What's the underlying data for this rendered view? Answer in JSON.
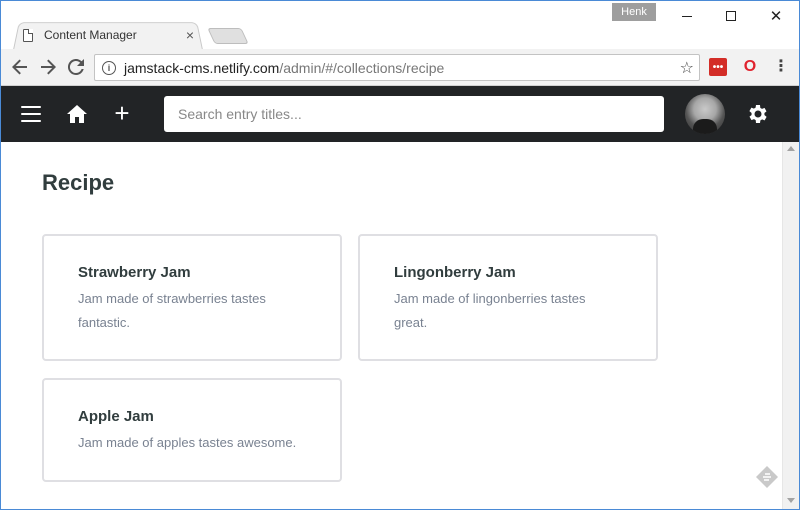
{
  "browser": {
    "tab_title": "Content Manager",
    "tab_close": "×",
    "profile_name": "Henk",
    "url_host": "jamstack-cms.netlify.com",
    "url_path": "/admin/#/collections/recipe",
    "icons": {
      "back": "arrow-left-icon",
      "forward": "arrow-right-icon",
      "reload": "reload-icon",
      "info": "info-icon",
      "star": "star-icon",
      "lastpass": "lastpass-icon",
      "opera": "opera-icon",
      "menu": "more-vert-icon"
    }
  },
  "app": {
    "header_bg": "#222426",
    "search_placeholder": "Search entry titles...",
    "icons": {
      "menu": "hamburger-icon",
      "home": "home-icon",
      "new": "plus-icon",
      "settings": "gear-icon"
    }
  },
  "collection": {
    "title": "Recipe",
    "entries": [
      {
        "title": "Strawberry Jam",
        "description": "Jam made of strawberries tastes fantastic."
      },
      {
        "title": "Lingonberry Jam",
        "description": "Jam made of lingonberries tastes great."
      },
      {
        "title": "Apple Jam",
        "description": "Jam made of apples tastes awesome."
      }
    ]
  }
}
